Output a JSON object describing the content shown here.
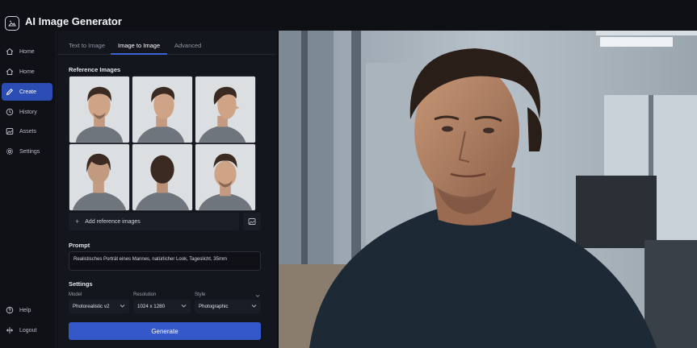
{
  "app": {
    "title": "AI Image Generator",
    "logo_icon": "image-sparkle-icon"
  },
  "sidebar": {
    "items": [
      {
        "label": "Home",
        "icon": "home-icon",
        "active": false
      },
      {
        "label": "Home",
        "icon": "home-icon",
        "active": false
      },
      {
        "label": "Create",
        "icon": "create-icon",
        "active": true
      },
      {
        "label": "History",
        "icon": "clock-icon",
        "active": false
      },
      {
        "label": "Assets",
        "icon": "image-icon",
        "active": false
      },
      {
        "label": "Settings",
        "icon": "gear-icon",
        "active": false
      }
    ],
    "bottom": [
      {
        "label": "Help",
        "icon": "help-icon"
      },
      {
        "label": "Logout",
        "icon": "logout-icon"
      }
    ]
  },
  "tabs": [
    {
      "label": "Text to Image",
      "active": false
    },
    {
      "label": "Image to Image",
      "active": true
    },
    {
      "label": "Advanced",
      "active": false
    }
  ],
  "reference": {
    "heading": "Reference Images",
    "add_label": "Add reference images",
    "upload_icon": "image-upload-icon"
  },
  "prompt": {
    "heading": "Prompt",
    "value": "Realistisches Porträt eines Mannes, natürlicher Look, Tageslicht, 35mm"
  },
  "settings": {
    "heading": "Settings",
    "model": {
      "label": "Model",
      "value": "Photorealistic v2"
    },
    "resolution": {
      "label": "Resolution",
      "value": "1024 x 1280"
    },
    "style": {
      "label": "Style",
      "value": "Photographic"
    }
  },
  "generate": {
    "label": "Generate"
  },
  "colors": {
    "accent": "#3558c8",
    "active_nav": "#2b4db3",
    "panel_bg": "#13161d",
    "app_bg": "#0b0d12"
  }
}
